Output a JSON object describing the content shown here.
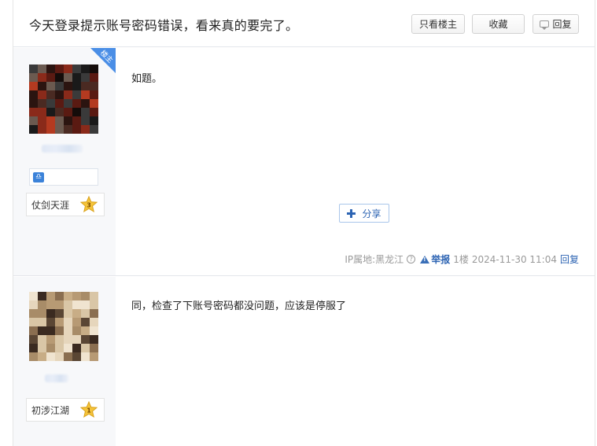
{
  "thread": {
    "title": "今天登录提示账号密码错误，看来真的要完了。",
    "only_op_label": "只看楼主",
    "favorite_label": "收藏",
    "reply_label": "回复"
  },
  "posts": [
    {
      "op_badge": "楼主",
      "level_name": "仗剑天涯",
      "level_num": "3",
      "content": "如题。",
      "share_label": "分享",
      "ip_label": "IP属地:黑龙江",
      "report_label": "举报",
      "floor": "1楼",
      "time": "2024-11-30 11:04",
      "reply_label": "回复"
    },
    {
      "level_name": "初涉江湖",
      "level_num": "1",
      "content": "同，检查了下账号密码都没问题，应该是停服了"
    }
  ],
  "colors": {
    "accent": "#2d64b3",
    "op_ribbon": "#4a8ee6",
    "sidebar_bg": "#f7f8fa",
    "star": "#f5c43a"
  },
  "icons": [
    "comment-bubble-icon",
    "plus-icon",
    "help-circle-icon",
    "warning-icon",
    "star-icon",
    "libra-icon"
  ]
}
